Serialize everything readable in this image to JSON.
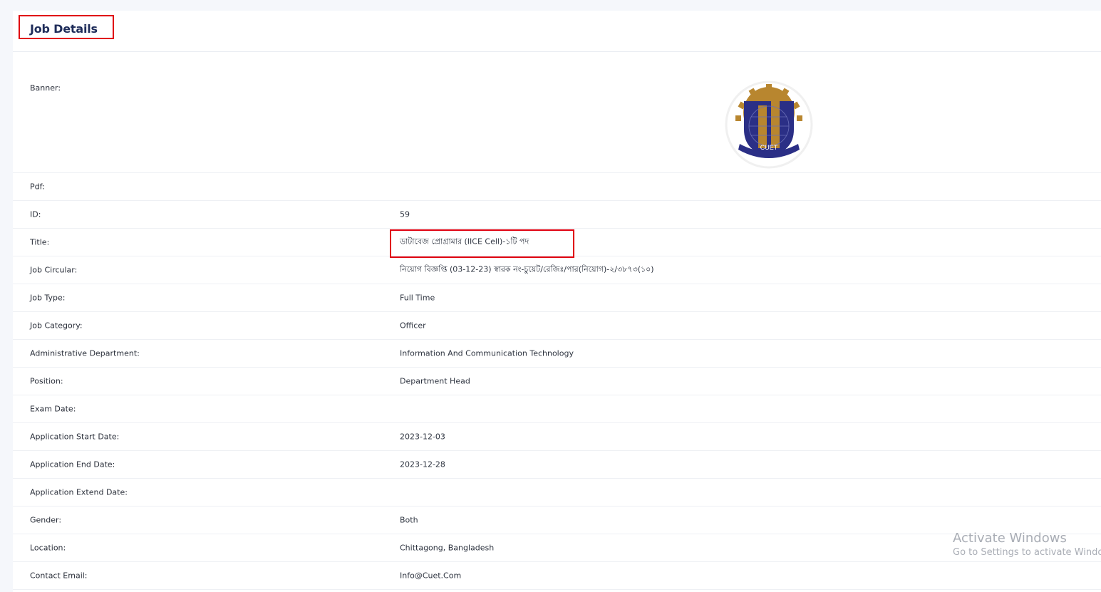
{
  "header": {
    "title": "Job Details"
  },
  "banner": {
    "label": "Banner:",
    "logo_text": "CUET"
  },
  "fields": [
    {
      "label": "Pdf:",
      "value": ""
    },
    {
      "label": "ID:",
      "value": "59"
    },
    {
      "label": "Title:",
      "value": "ডাটাবেজ প্রোগ্রামার (IICE Cell)-১টি পদ"
    },
    {
      "label": "Job Circular:",
      "value": "নিয়োগ বিজ্ঞপ্তি (03-12-23) স্বারক নং-চুয়েট/রেজিঃ/পার(নিয়োগ)-২/৩৮৭৩(১০)"
    },
    {
      "label": "Job Type:",
      "value": "Full Time"
    },
    {
      "label": "Job Category:",
      "value": "Officer"
    },
    {
      "label": "Administrative Department:",
      "value": "Information And Communication Technology"
    },
    {
      "label": "Position:",
      "value": "Department Head"
    },
    {
      "label": "Exam Date:",
      "value": ""
    },
    {
      "label": "Application Start Date:",
      "value": "2023-12-03"
    },
    {
      "label": "Application End Date:",
      "value": "2023-12-28"
    },
    {
      "label": "Application Extend Date:",
      "value": ""
    },
    {
      "label": "Gender:",
      "value": "Both"
    },
    {
      "label": "Location:",
      "value": "Chittagong, Bangladesh"
    },
    {
      "label": "Contact Email:",
      "value": "Info@Cuet.Com"
    }
  ],
  "watermark": {
    "line1": "Activate Windows",
    "line2": "Go to Settings to activate Windows."
  },
  "colors": {
    "highlight": "#e0000f",
    "title": "#1f2d5a",
    "logo_navy": "#2b2f86",
    "logo_gold": "#b8862f"
  }
}
